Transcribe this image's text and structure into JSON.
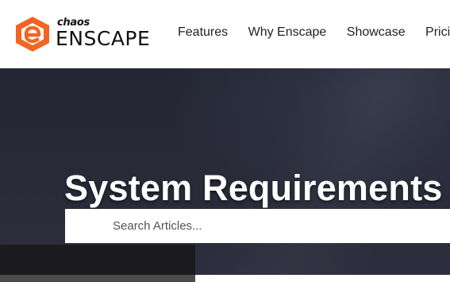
{
  "logo": {
    "brand": "chaos",
    "name": "ENSCAPE",
    "mark_color": "#f26522"
  },
  "nav": {
    "items": [
      {
        "label": "Features"
      },
      {
        "label": "Why Enscape"
      },
      {
        "label": "Showcase"
      },
      {
        "label": "Pricing"
      }
    ]
  },
  "hero": {
    "title": "System Requirements"
  },
  "search": {
    "placeholder": "Search Articles..."
  },
  "colors": {
    "accent": "#f26522",
    "hero_bg": "#292b39"
  }
}
